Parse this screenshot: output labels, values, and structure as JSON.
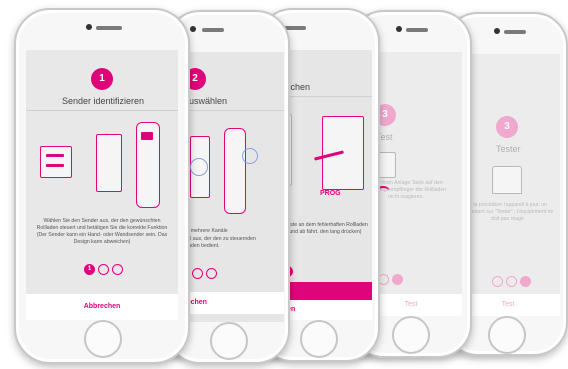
{
  "phones": {
    "p1": {
      "step": "1",
      "title": "Sender identifizieren",
      "description": "Wählen Sie den Sender aus, der den gewünschten Rollladen steuert und betätigen Sie die korrekte Funktion (Der Sender kann ein Hand- oder Wandsender sein. Das Design kann abweichen)",
      "dots": [
        "1",
        "",
        ""
      ],
      "button": "Abbrechen"
    },
    "p2": {
      "step": "2",
      "title": "auswählen",
      "description": "Kanal aus, der den zu steuernden Rollladen bedient.",
      "description_top": "sung mehrere Kanäle",
      "button": "rechen"
    },
    "p3": {
      "step": "3",
      "title": "s löschen",
      "label_left": "OG",
      "label_right": "PROG",
      "description": "grammiertaste an dem fehlerhaften Rollladen einmal auf und ab fährt. den lang drücken)",
      "button_primary": "Weiter",
      "button_secondary": "brechen"
    },
    "p4": {
      "step": "3",
      "title": "Test",
      "description": "oder Ihren Anlage Taste auf den Empfangsempfänger der Rollladen nicht reagieren.",
      "button": "Test"
    },
    "p5": {
      "step": "3",
      "title": "Tester",
      "description": "a la procédure l'appareil à jour, un clignotant sur \"Tester\" ; l'équipement ne doit pas réagir.",
      "button": "Test"
    }
  },
  "colors": {
    "accent": "#e0047a",
    "accent_soft": "#f0a9cd",
    "screen_bg": "#e6e6e6"
  }
}
